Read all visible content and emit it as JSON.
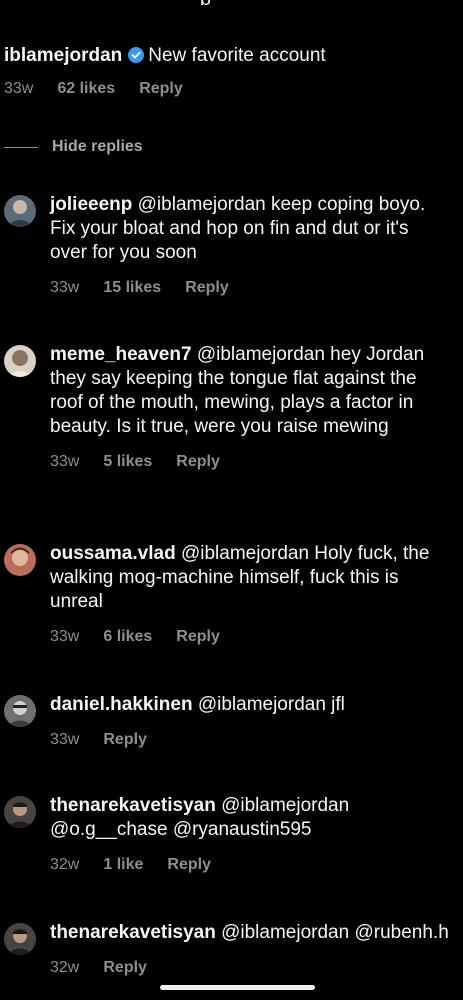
{
  "parent_comment": {
    "username": "iblamejordan",
    "text": "New favorite account",
    "time": "33w",
    "likes": "62 likes",
    "reply_label": "Reply"
  },
  "hide_replies": "Hide replies",
  "replies": [
    {
      "username": "jolieeenp",
      "text": "@iblamejordan keep coping boyo. Fix your bloat and hop on fin and dut or it's over for you soon",
      "time": "33w",
      "likes": "15 likes",
      "reply_label": "Reply"
    },
    {
      "username": "meme_heaven7",
      "text": "@iblamejordan hey Jordan they say keeping the tongue flat against the roof of the mouth, mewing, plays a factor in beauty. Is it true, were you raise mewing",
      "time": "33w",
      "likes": "5 likes",
      "reply_label": "Reply"
    },
    {
      "username": "oussama.vlad",
      "text": "@iblamejordan Holy fuck, the walking mog-machine himself, fuck this is unreal",
      "time": "33w",
      "likes": "6 likes",
      "reply_label": "Reply"
    },
    {
      "username": "daniel.hakkinen",
      "text": "@iblamejordan jfl",
      "time": "33w",
      "likes": "",
      "reply_label": "Reply"
    },
    {
      "username": "thenarekavetisyan",
      "text": "@iblamejordan @o.g__chase @ryanaustin595",
      "time": "32w",
      "likes": "1 like",
      "reply_label": "Reply"
    },
    {
      "username": "thenarekavetisyan",
      "text": "@iblamejordan @rubenh.h",
      "time": "32w",
      "likes": "",
      "reply_label": "Reply"
    }
  ],
  "colors": {
    "background": "#000000",
    "text": "#f5f5f5",
    "meta": "#8e8e8e",
    "verified": "#3897f0"
  }
}
